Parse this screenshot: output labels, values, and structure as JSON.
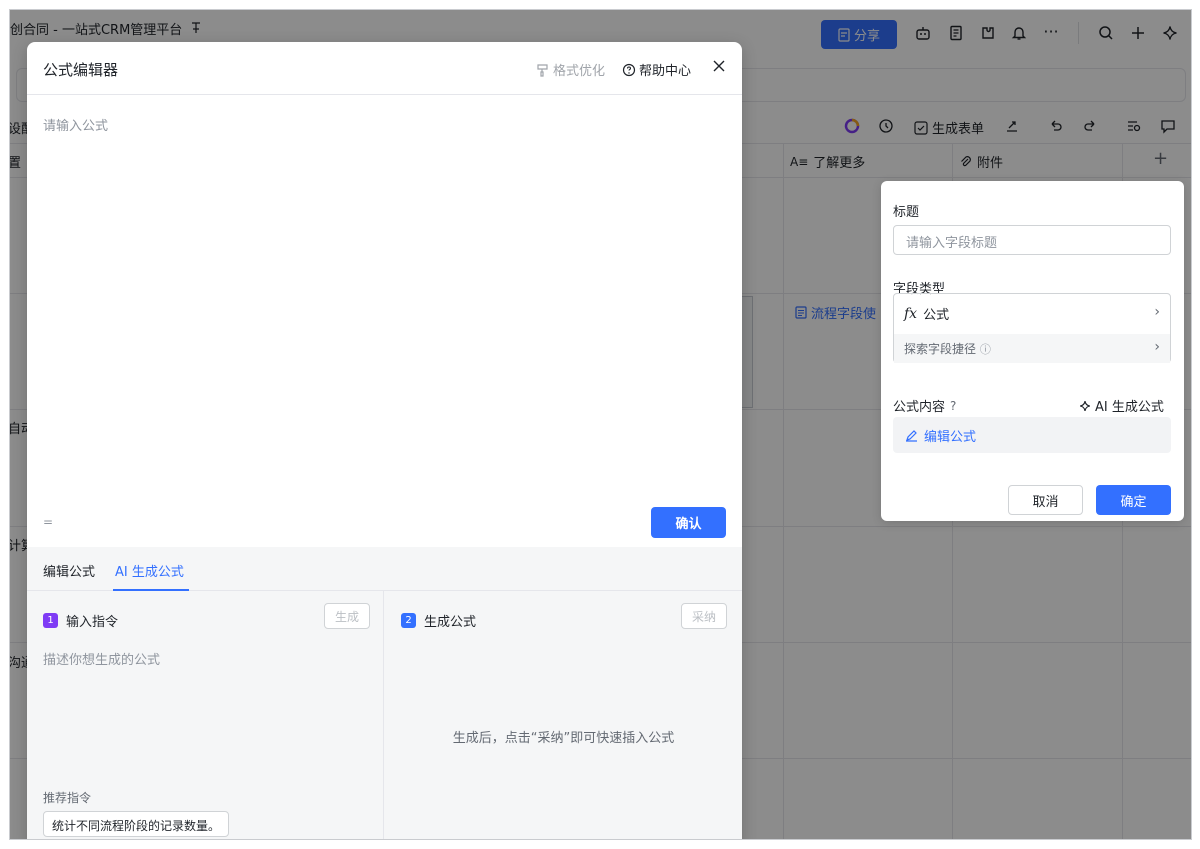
{
  "app": {
    "doc_title": "创合同 - 一站式CRM管理平台",
    "pin_icon": "pin-icon",
    "share_label": "分享",
    "toolbar_icons": [
      "robot-icon",
      "doc-icon",
      "plugin-icon",
      "bell-icon",
      "more-icon",
      "search-icon",
      "plus-icon",
      "ai-sparkle-icon"
    ],
    "view_toolbar": {
      "generate_form": "生成表单"
    },
    "columns": {
      "learn_more": "了解更多",
      "attachment": "附件",
      "add": "+"
    },
    "left_fragments": [
      "设配",
      "置",
      "自动",
      "计算",
      "沟通"
    ],
    "cell_link": "流程字段使"
  },
  "field_panel": {
    "title_label": "标题",
    "title_placeholder": "请输入字段标题",
    "type_label": "字段类型",
    "type_value": "公式",
    "explore_label": "探索字段捷径",
    "content_label": "公式内容",
    "ai_generate": "AI 生成公式",
    "edit_formula": "编辑公式",
    "cancel": "取消",
    "confirm": "确定"
  },
  "modal": {
    "title": "公式编辑器",
    "format_label": "格式优化",
    "help_label": "帮助中心",
    "editor_placeholder": "请输入公式",
    "equals": "=",
    "confirm_label": "确认",
    "tabs": [
      "编辑公式",
      "AI 生成公式"
    ],
    "active_tab": "AI 生成公式",
    "step1": {
      "num": "1",
      "label": "输入指令",
      "button": "生成",
      "placeholder": "描述你想生成的公式"
    },
    "step2": {
      "num": "2",
      "label": "生成公式",
      "button": "采纳",
      "hint": "生成后，点击“采纳”即可快速插入公式"
    },
    "recommend_label": "推荐指令",
    "recommend_chip": "统计不同流程阶段的记录数量。"
  },
  "colors": {
    "accent": "#3370ff",
    "step1": "#7f3bf5",
    "step2": "#3370ff"
  }
}
